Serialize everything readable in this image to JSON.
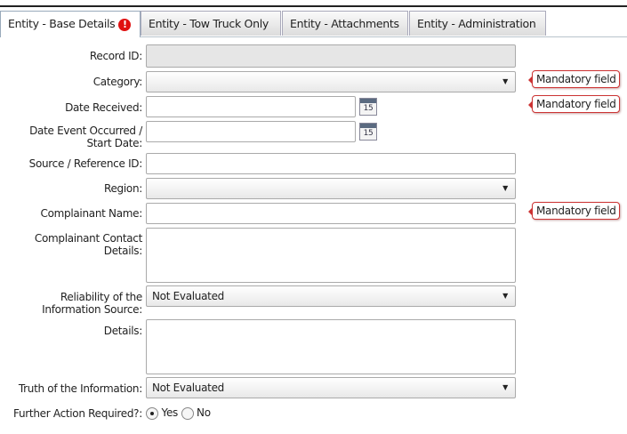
{
  "tabs": [
    {
      "label": "Entity - Base Details",
      "active": true,
      "error": "!"
    },
    {
      "label": "Entity - Tow Truck Only"
    },
    {
      "label": "Entity - Attachments"
    },
    {
      "label": "Entity - Administration"
    }
  ],
  "fields": {
    "record_id": {
      "label": "Record ID:",
      "value": ""
    },
    "category": {
      "label": "Category:",
      "value": ""
    },
    "date_received": {
      "label": "Date Received:",
      "value": "",
      "calendar": "15"
    },
    "date_event": {
      "label": "Date Event Occurred / Start Date:",
      "value": "",
      "calendar": "15"
    },
    "source_ref": {
      "label": "Source / Reference ID:",
      "value": ""
    },
    "region": {
      "label": "Region:",
      "value": ""
    },
    "complainant_name": {
      "label": "Complainant Name:",
      "value": ""
    },
    "complainant_contact": {
      "label": "Complainant Contact Details:",
      "value": ""
    },
    "reliability": {
      "label": "Reliability of the Information Source:",
      "value": "Not Evaluated"
    },
    "details": {
      "label": "Details:",
      "value": ""
    },
    "truth": {
      "label": "Truth of the Information:",
      "value": "Not Evaluated"
    },
    "further_action": {
      "label": "Further Action Required?:",
      "options": [
        "Yes",
        "No"
      ],
      "selected": "Yes"
    }
  },
  "mandatory": "Mandatory field"
}
